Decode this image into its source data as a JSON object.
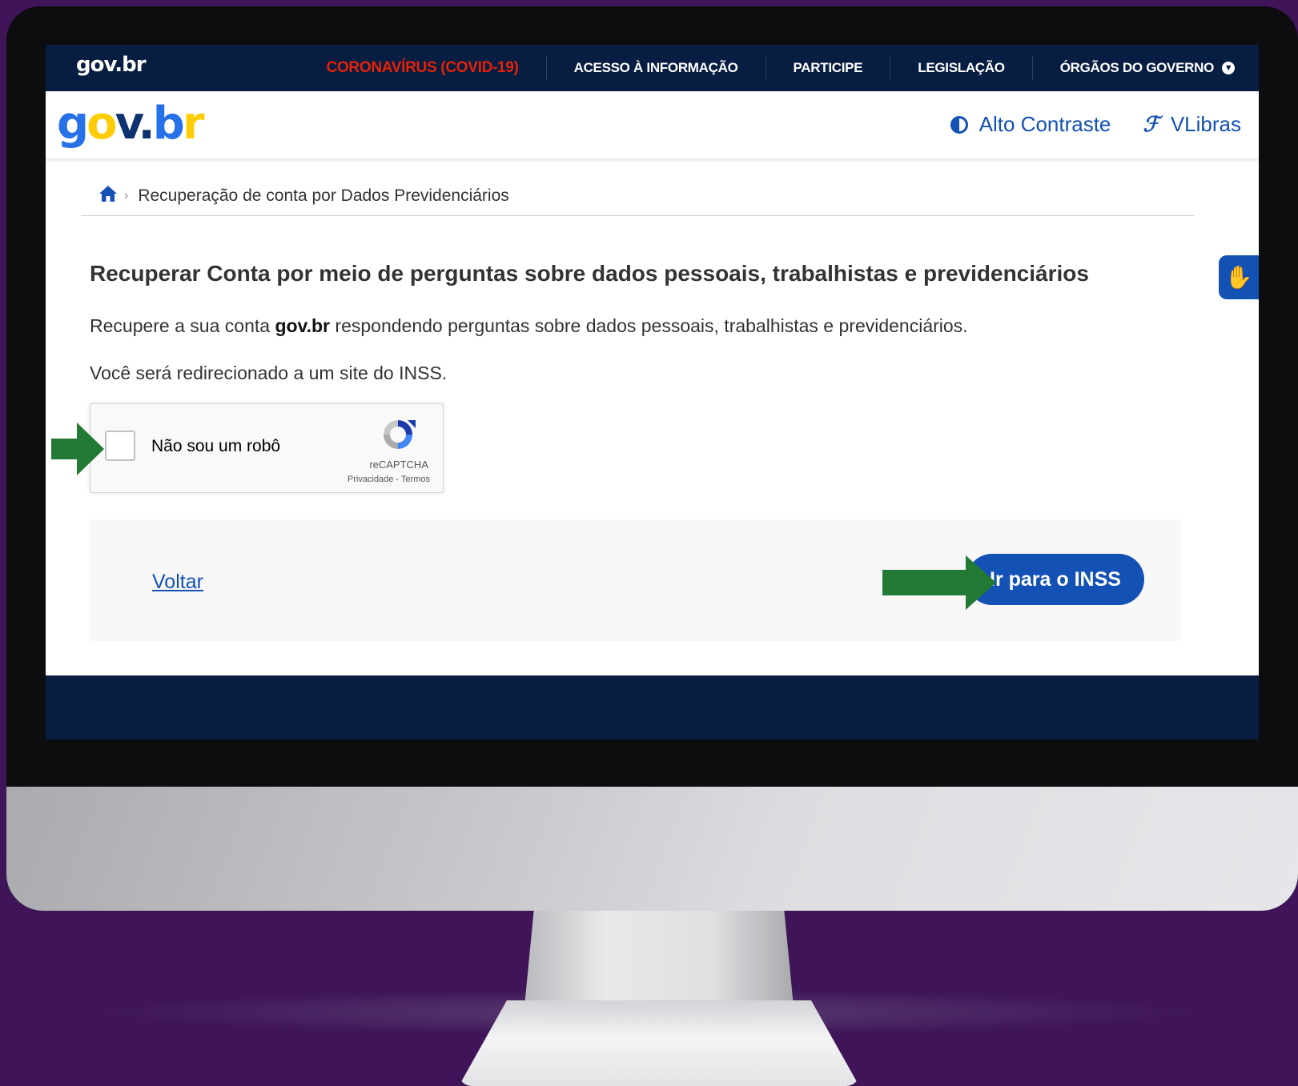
{
  "topbar": {
    "logo": "gov.br",
    "nav": [
      {
        "label": "CORONAVÍRUS (COVID-19)"
      },
      {
        "label": "ACESSO À INFORMAÇÃO"
      },
      {
        "label": "PARTICIPE"
      },
      {
        "label": "LEGISLAÇÃO"
      },
      {
        "label": "ÓRGÃOS DO GOVERNO"
      }
    ],
    "covid_color": "#e52207"
  },
  "header": {
    "contrast_label": "Alto Contraste",
    "vlibras_label": "VLibras",
    "contrast_icon": "contrast-icon",
    "ear_icon": "ear-icon"
  },
  "breadcrumb": {
    "home_icon": "home-icon",
    "current": "Recuperação de conta por Dados Previdenciários"
  },
  "main": {
    "title": "Recuperar Conta por meio de perguntas sobre dados pessoais, trabalhistas e previdenciários",
    "intro_before": "Recupere a sua conta ",
    "intro_bold": "gov.br",
    "intro_after": " respondendo perguntas sobre dados pessoais, trabalhistas e previdenciários.",
    "redirect_note": "Você será redirecionado a um site do INSS."
  },
  "recaptcha": {
    "label": "Não sou um robô",
    "brand": "reCAPTCHA",
    "links": "Privacidade - Termos",
    "checked": false
  },
  "actions": {
    "back_label": "Voltar",
    "primary_label": "Ir para o INSS"
  },
  "colors": {
    "primary": "#1351b4",
    "navy": "#071d41",
    "arrow": "#237a34",
    "background": "#3f1459"
  }
}
